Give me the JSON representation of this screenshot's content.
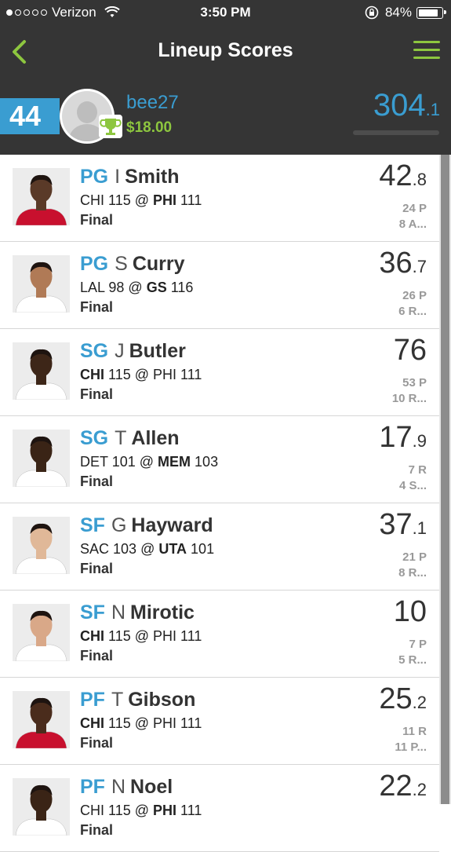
{
  "status_bar": {
    "carrier": "Verizon",
    "time": "3:50 PM",
    "battery": "84%",
    "signal_bars": 1,
    "signal_total": 5
  },
  "nav": {
    "title": "Lineup Scores",
    "back_icon": "chevron-left-icon",
    "menu_icon": "hamburger-menu-icon"
  },
  "user": {
    "rank": "44",
    "username": "bee27",
    "winnings": "$18.00",
    "total_score": "304",
    "total_score_decimal": ".1"
  },
  "colors": {
    "accent_blue": "#3a9dd1",
    "accent_green": "#8dc63f",
    "header_bg": "#353535"
  },
  "players": [
    {
      "pos": "PG",
      "initial": "I",
      "last": "Smith",
      "away": "CHI",
      "away_score": "115",
      "home": "PHI",
      "home_score": "111",
      "bold": "home",
      "status": "Final",
      "score": "42",
      "score_decimal": ".8",
      "stat1": "24 P",
      "stat2": "8 A...",
      "jersey": "#c8102e",
      "skin": "#5a3a28"
    },
    {
      "pos": "PG",
      "initial": "S",
      "last": "Curry",
      "away": "LAL",
      "away_score": "98",
      "home": "GS",
      "home_score": "116",
      "bold": "home",
      "status": "Final",
      "score": "36",
      "score_decimal": ".7",
      "stat1": "26 P",
      "stat2": "6 R...",
      "jersey": "#ffffff",
      "skin": "#b07a56"
    },
    {
      "pos": "SG",
      "initial": "J",
      "last": "Butler",
      "away": "CHI",
      "away_score": "115",
      "home": "PHI",
      "home_score": "111",
      "bold": "away",
      "status": "Final",
      "score": "76",
      "score_decimal": "",
      "stat1": "53 P",
      "stat2": "10 R...",
      "jersey": "#ffffff",
      "skin": "#3d2618"
    },
    {
      "pos": "SG",
      "initial": "T",
      "last": "Allen",
      "away": "DET",
      "away_score": "101",
      "home": "MEM",
      "home_score": "103",
      "bold": "home",
      "status": "Final",
      "score": "17",
      "score_decimal": ".9",
      "stat1": "7 R",
      "stat2": "4 S...",
      "jersey": "#ffffff",
      "skin": "#3a2416"
    },
    {
      "pos": "SF",
      "initial": "G",
      "last": "Hayward",
      "away": "SAC",
      "away_score": "103",
      "home": "UTA",
      "home_score": "101",
      "bold": "home",
      "status": "Final",
      "score": "37",
      "score_decimal": ".1",
      "stat1": "21 P",
      "stat2": "8 R...",
      "jersey": "#ffffff",
      "skin": "#e0b898"
    },
    {
      "pos": "SF",
      "initial": "N",
      "last": "Mirotic",
      "away": "CHI",
      "away_score": "115",
      "home": "PHI",
      "home_score": "111",
      "bold": "away",
      "status": "Final",
      "score": "10",
      "score_decimal": "",
      "stat1": "7 P",
      "stat2": "5 R...",
      "jersey": "#ffffff",
      "skin": "#d9a888"
    },
    {
      "pos": "PF",
      "initial": "T",
      "last": "Gibson",
      "away": "CHI",
      "away_score": "115",
      "home": "PHI",
      "home_score": "111",
      "bold": "away",
      "status": "Final",
      "score": "25",
      "score_decimal": ".2",
      "stat1": "11 R",
      "stat2": "11 P...",
      "jersey": "#c8102e",
      "skin": "#4a2c1c"
    },
    {
      "pos": "PF",
      "initial": "N",
      "last": "Noel",
      "away": "CHI",
      "away_score": "115",
      "home": "PHI",
      "home_score": "111",
      "bold": "home",
      "status": "Final",
      "score": "22",
      "score_decimal": ".2",
      "stat1": "",
      "stat2": "",
      "jersey": "#ffffff",
      "skin": "#3a2416"
    }
  ]
}
